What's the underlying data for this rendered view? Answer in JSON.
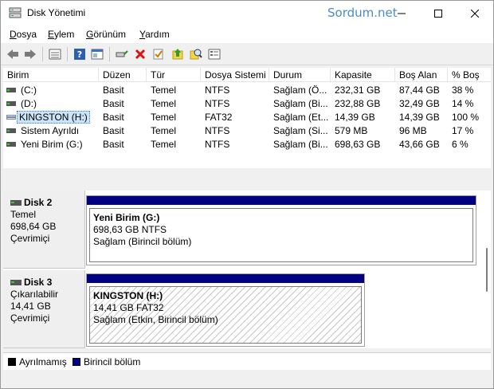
{
  "window": {
    "title": "Disk Yönetimi",
    "watermark": "Sordum.net"
  },
  "menu": [
    {
      "first": "D",
      "rest": "osya"
    },
    {
      "first": "E",
      "rest": "ylem"
    },
    {
      "first": "G",
      "rest": "örünüm"
    },
    {
      "first": "Y",
      "rest": "ardım"
    }
  ],
  "toolbar": {
    "icons": [
      "back-icon",
      "forward-icon",
      "properties-icon",
      "help-icon",
      "console-icon",
      "connect-icon",
      "delete-icon",
      "check-icon",
      "up-icon",
      "search-icon",
      "details-icon"
    ]
  },
  "volume_list": {
    "columns": [
      "Birim",
      "Düzen",
      "Tür",
      "Dosya Sistemi",
      "Durum",
      "Kapasite",
      "Boş Alan",
      "% Boş"
    ],
    "rows": [
      {
        "name": "(C:)",
        "layout": "Basit",
        "type": "Temel",
        "fs": "NTFS",
        "status": "Sağlam (Ö...",
        "capacity": "232,31 GB",
        "free": "87,44 GB",
        "pct": "38 %"
      },
      {
        "name": "(D:)",
        "layout": "Basit",
        "type": "Temel",
        "fs": "NTFS",
        "status": "Sağlam (Bi...",
        "capacity": "232,88 GB",
        "free": "32,49 GB",
        "pct": "14 %"
      },
      {
        "name": "KINGSTON (H:)",
        "layout": "Basit",
        "type": "Temel",
        "fs": "FAT32",
        "status": "Sağlam (Et...",
        "capacity": "14,39 GB",
        "free": "14,39 GB",
        "pct": "100 %"
      },
      {
        "name": "Sistem Ayrıldı",
        "layout": "Basit",
        "type": "Temel",
        "fs": "NTFS",
        "status": "Sağlam (Si...",
        "capacity": "579 MB",
        "free": "96 MB",
        "pct": "17 %"
      },
      {
        "name": "Yeni Birim (G:)",
        "layout": "Basit",
        "type": "Temel",
        "fs": "NTFS",
        "status": "Sağlam (Bi...",
        "capacity": "698,63 GB",
        "free": "43,66 GB",
        "pct": "6 %"
      }
    ]
  },
  "disks": [
    {
      "title": "Disk 2",
      "kind": "Temel",
      "size": "698,64 GB",
      "state": "Çevrimiçi",
      "partition": {
        "name": "Yeni Birim  (G:)",
        "detail": "698,63 GB NTFS",
        "status": "Sağlam (Birincil bölüm)"
      }
    },
    {
      "title": "Disk 3",
      "kind": "Çıkarılabilir",
      "size": "14,41 GB",
      "state": "Çevrimiçi",
      "partition": {
        "name": "KINGSTON  (H:)",
        "detail": "14,41 GB FAT32",
        "status": "Sağlam (Etkin, Birincil bölüm)"
      }
    }
  ],
  "legend": {
    "unallocated": "Ayrılmamış",
    "primary": "Birincil bölüm",
    "unallocated_color": "#000000",
    "primary_color": "#000080"
  }
}
